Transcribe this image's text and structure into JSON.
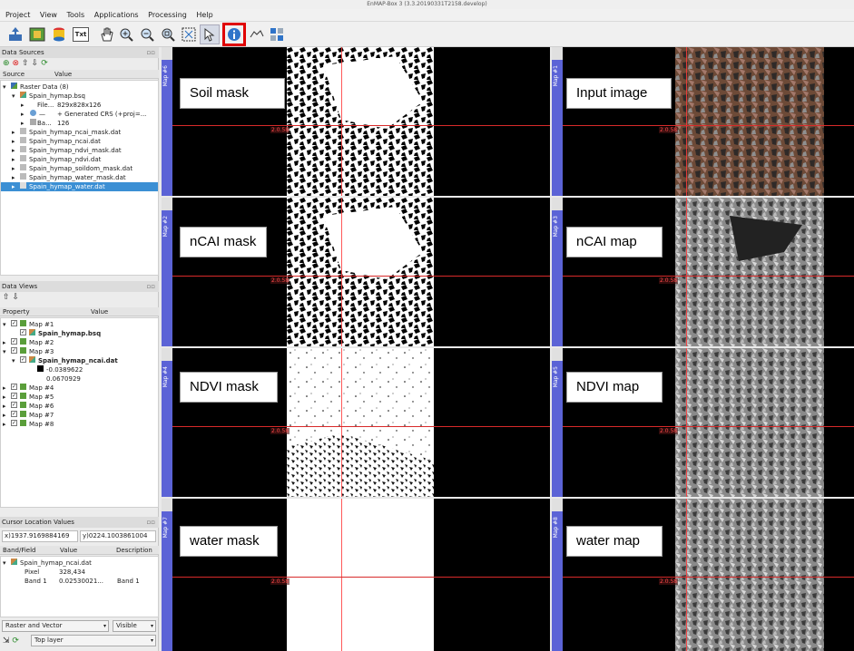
{
  "window": {
    "title": "EnMAP-Box 3 (3.3.20190331T2158.develop)"
  },
  "menu": [
    "Project",
    "View",
    "Tools",
    "Applications",
    "Processing",
    "Help"
  ],
  "toolbar": {
    "txt_label": "Txt"
  },
  "data_sources": {
    "title": "Data Sources",
    "col_source": "Source",
    "col_value": "Value",
    "items": [
      {
        "label": "Raster Data (8)",
        "value": ""
      },
      {
        "label": "Spain_hymap.bsq",
        "value": ""
      },
      {
        "label": "File...",
        "value": "829x828x126"
      },
      {
        "label": "",
        "value": "+ Generated CRS (+proj=..."
      },
      {
        "label": "Ba...",
        "value": "126"
      },
      {
        "label": "Spain_hymap_ncai_mask.dat",
        "value": ""
      },
      {
        "label": "Spain_hymap_ncai.dat",
        "value": ""
      },
      {
        "label": "Spain_hymap_ndvi_mask.dat",
        "value": ""
      },
      {
        "label": "Spain_hymap_ndvi.dat",
        "value": ""
      },
      {
        "label": "Spain_hymap_soildom_mask.dat",
        "value": ""
      },
      {
        "label": "Spain_hymap_water_mask.dat",
        "value": ""
      },
      {
        "label": "Spain_hymap_water.dat",
        "value": ""
      }
    ]
  },
  "data_views": {
    "title": "Data Views",
    "col_property": "Property",
    "col_value": "Value",
    "items": [
      {
        "label": "Map #1"
      },
      {
        "label": "Spain_hymap.bsq"
      },
      {
        "label": "Map #2"
      },
      {
        "label": "Map #3"
      },
      {
        "label": "Spain_hymap_ncai.dat"
      },
      {
        "label": "-0.0389622"
      },
      {
        "label": "0.0670929"
      },
      {
        "label": "Map #4"
      },
      {
        "label": "Map #5"
      },
      {
        "label": "Map #6"
      },
      {
        "label": "Map #7"
      },
      {
        "label": "Map #8"
      }
    ]
  },
  "cursor": {
    "title": "Cursor Location Values",
    "x_value": "x)1937.9169884169",
    "y_value": "y)0224.1003861004",
    "col_band": "Band/Field",
    "col_value": "Value",
    "col_desc": "Description",
    "file": "Spain_hymap_ncai.dat",
    "pixel_label": "Pixel",
    "pixel_value": "328,434",
    "band_label": "Band 1",
    "band_value": "0.02530021...",
    "band_desc": "Band 1",
    "mode_combo": "Raster and Vector",
    "visible_combo": "Visible",
    "layer_combo": "Top layer"
  },
  "maps": [
    {
      "strip": "Map #6",
      "label": "Soil mask",
      "coord": "2.0.58"
    },
    {
      "strip": "Map #1",
      "label": "Input image",
      "coord": "2.0.58"
    },
    {
      "strip": "Map #2",
      "label": "nCAI mask",
      "coord": "2.0.58"
    },
    {
      "strip": "Map #3",
      "label": "nCAI map",
      "coord": "2.0.58"
    },
    {
      "strip": "Map #4",
      "label": "NDVI mask",
      "coord": "2.0.58"
    },
    {
      "strip": "Map #5",
      "label": "NDVI map",
      "coord": "2.0.58"
    },
    {
      "strip": "Map #7",
      "label": "water mask",
      "coord": "2.0.58"
    },
    {
      "strip": "Map #8",
      "label": "water map",
      "coord": "2.0.58"
    }
  ],
  "colors": {
    "accent": "#5b63d6",
    "highlight": "#e00000",
    "selection": "#3b8fd4",
    "crosshair": "#ff3c3c"
  }
}
